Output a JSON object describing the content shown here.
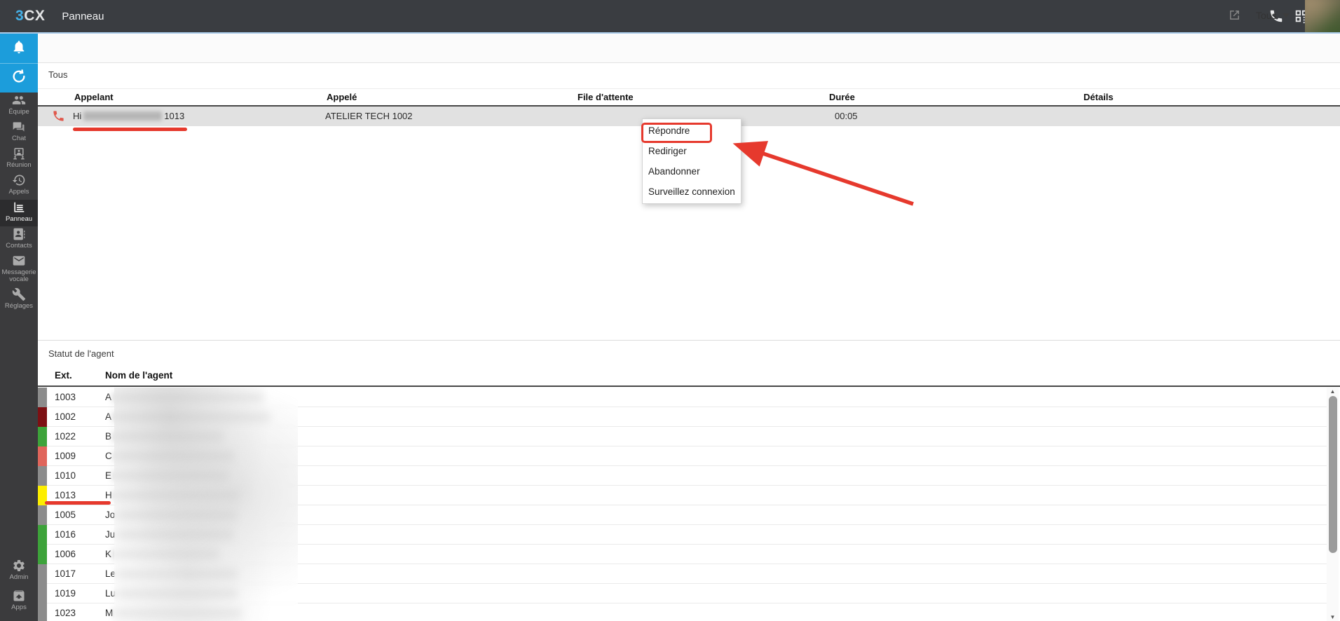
{
  "topbar": {
    "logo_part1": "3",
    "logo_part2": "CX",
    "title": "Panneau"
  },
  "toolbar": {
    "filter_selected": "Tous"
  },
  "calls": {
    "section_title": "Tous",
    "columns": [
      "Appelant",
      "Appelé",
      "File d'attente",
      "Durée",
      "Détails"
    ],
    "row": {
      "caller_prefix": "Hi",
      "caller_ext": "1013",
      "callee": "ATELIER TECH 1002",
      "queue": "",
      "duration": "00:05",
      "details": ""
    }
  },
  "context_menu": {
    "items": [
      "Répondre",
      "Rediriger",
      "Abandonner",
      "Surveillez connexion"
    ],
    "highlighted_item": "Répondre"
  },
  "agents": {
    "section_title": "Statut de l'agent",
    "columns": [
      "Ext.",
      "Nom de l'agent"
    ],
    "rows": [
      {
        "ext": "1003",
        "name_prefix": "A",
        "status_color": "#8c8c8c"
      },
      {
        "ext": "1002",
        "name_prefix": "A",
        "status_color": "#7d1013"
      },
      {
        "ext": "1022",
        "name_prefix": "B",
        "status_color": "#3da33a"
      },
      {
        "ext": "1009",
        "name_prefix": "C",
        "status_color": "#e0655b"
      },
      {
        "ext": "1010",
        "name_prefix": "E",
        "status_color": "#8c8c8c"
      },
      {
        "ext": "1013",
        "name_prefix": "H",
        "status_color": "#fdee00"
      },
      {
        "ext": "1005",
        "name_prefix": "Jo",
        "status_color": "#8c8c8c"
      },
      {
        "ext": "1016",
        "name_prefix": "Ju",
        "status_color": "#3da33a"
      },
      {
        "ext": "1006",
        "name_prefix": "K",
        "status_color": "#3da33a"
      },
      {
        "ext": "1017",
        "name_prefix": "Le",
        "status_color": "#8c8c8c"
      },
      {
        "ext": "1019",
        "name_prefix": "Lu",
        "status_color": "#8c8c8c"
      },
      {
        "ext": "1023",
        "name_prefix": "M",
        "status_color": "#8c8c8c"
      }
    ]
  },
  "sidebar": {
    "items": [
      {
        "label": "Équipe"
      },
      {
        "label": "Chat"
      },
      {
        "label": "Réunion"
      },
      {
        "label": "Appels"
      },
      {
        "label": "Panneau"
      },
      {
        "label": "Contacts"
      },
      {
        "label": "Messagerie vocale"
      },
      {
        "label": "Réglages"
      }
    ],
    "bottom_items": [
      {
        "label": "Admin"
      },
      {
        "label": "Apps"
      }
    ]
  },
  "colors": {
    "accent_blue": "#1c9ddb",
    "annotation_red": "#e6392d",
    "call_row_bg": "#e1e1e1",
    "status_grey": "#8c8c8c",
    "status_darkred": "#7d1013",
    "status_green": "#3da33a",
    "status_salmon": "#e0655b",
    "status_yellow": "#fdee00"
  }
}
